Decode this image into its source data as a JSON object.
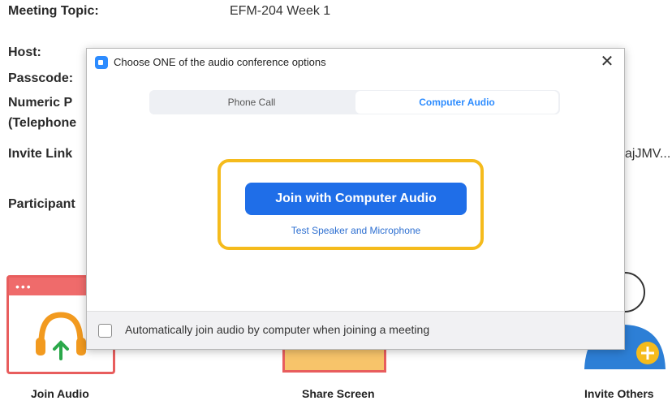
{
  "meeting_info": {
    "topic_label": "Meeting Topic:",
    "topic_value": "EFM-204 Week 1",
    "host_label": "Host:",
    "passcode_label": "Passcode:",
    "numeric_label_line1": "Numeric P",
    "numeric_label_line2": "(Telephone",
    "invite_label": "Invite Link",
    "invite_value_partial": "ajJMV...",
    "participants_label": "Participant"
  },
  "actions": {
    "join_audio": "Join Audio",
    "share_screen": "Share Screen",
    "invite_others": "Invite Others"
  },
  "dialog": {
    "title": "Choose ONE of the audio conference options",
    "close_symbol": "✕",
    "tabs": [
      {
        "label": "Phone Call",
        "selected": false
      },
      {
        "label": "Computer Audio",
        "selected": true
      }
    ],
    "join_button": "Join with Computer Audio",
    "test_link": "Test Speaker and Microphone",
    "auto_join_label": "Automatically join audio by computer when joining a meeting",
    "auto_join_checked": false
  },
  "colors": {
    "zoom_blue": "#2d8cff",
    "join_button": "#1f6ee8",
    "highlight_ring": "#f5bb1c",
    "tile_red": "#e85d5d"
  }
}
